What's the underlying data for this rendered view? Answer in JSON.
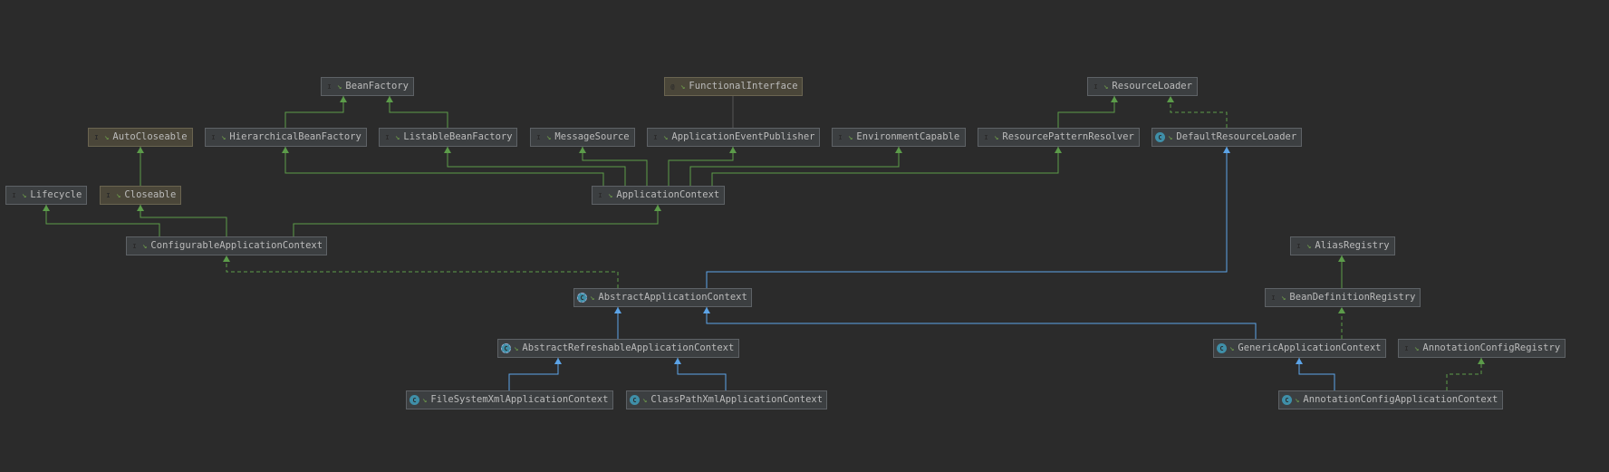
{
  "colors": {
    "background": "#2b2b2b",
    "interface_extends": "#5c9c4a",
    "class_extends": "#5ca4e8",
    "implements": "#5c9c4a"
  },
  "nodes": {
    "beanfactory": {
      "label": "BeanFactory",
      "kind": "interface"
    },
    "functionalinterface": {
      "label": "FunctionalInterface",
      "kind": "annotation"
    },
    "resourceloader": {
      "label": "ResourceLoader",
      "kind": "interface"
    },
    "autocloseable": {
      "label": "AutoCloseable",
      "kind": "interface"
    },
    "hierarchicalbeanfactory": {
      "label": "HierarchicalBeanFactory",
      "kind": "interface"
    },
    "listablebeanfactory": {
      "label": "ListableBeanFactory",
      "kind": "interface"
    },
    "messagesource": {
      "label": "MessageSource",
      "kind": "interface"
    },
    "applicationeventpublisher": {
      "label": "ApplicationEventPublisher",
      "kind": "interface"
    },
    "environmentcapable": {
      "label": "EnvironmentCapable",
      "kind": "interface"
    },
    "resourcepatternresolver": {
      "label": "ResourcePatternResolver",
      "kind": "interface"
    },
    "defaultresourceloader": {
      "label": "DefaultResourceLoader",
      "kind": "class"
    },
    "lifecycle": {
      "label": "Lifecycle",
      "kind": "interface"
    },
    "closeable": {
      "label": "Closeable",
      "kind": "interface"
    },
    "applicationcontext": {
      "label": "ApplicationContext",
      "kind": "interface"
    },
    "configurableapplicationcontext": {
      "label": "ConfigurableApplicationContext",
      "kind": "interface"
    },
    "aliasregistry": {
      "label": "AliasRegistry",
      "kind": "interface"
    },
    "abstractapplicationcontext": {
      "label": "AbstractApplicationContext",
      "kind": "abstract-class"
    },
    "beandefinitionregistry": {
      "label": "BeanDefinitionRegistry",
      "kind": "interface"
    },
    "abstractrefreshableapplicationcontext": {
      "label": "AbstractRefreshableApplicationContext",
      "kind": "abstract-class"
    },
    "genericapplicationcontext": {
      "label": "GenericApplicationContext",
      "kind": "class"
    },
    "annotationconfigregistry": {
      "label": "AnnotationConfigRegistry",
      "kind": "interface"
    },
    "filesystemxmlapplicationcontext": {
      "label": "FileSystemXmlApplicationContext",
      "kind": "class"
    },
    "classpathxmlapplicationcontext": {
      "label": "ClassPathXmlApplicationContext",
      "kind": "class"
    },
    "annotationconfigapplicationcontext": {
      "label": "AnnotationConfigApplicationContext",
      "kind": "class"
    }
  },
  "edges": [
    {
      "from": "hierarchicalbeanfactory",
      "to": "beanfactory",
      "type": "interface_extends"
    },
    {
      "from": "listablebeanfactory",
      "to": "beanfactory",
      "type": "interface_extends"
    },
    {
      "from": "closeable",
      "to": "autocloseable",
      "type": "interface_extends"
    },
    {
      "from": "resourcepatternresolver",
      "to": "resourceloader",
      "type": "interface_extends"
    },
    {
      "from": "defaultresourceloader",
      "to": "resourceloader",
      "type": "implements"
    },
    {
      "from": "applicationcontext",
      "to": "hierarchicalbeanfactory",
      "type": "interface_extends"
    },
    {
      "from": "applicationcontext",
      "to": "listablebeanfactory",
      "type": "interface_extends"
    },
    {
      "from": "applicationcontext",
      "to": "messagesource",
      "type": "interface_extends"
    },
    {
      "from": "applicationcontext",
      "to": "applicationeventpublisher",
      "type": "interface_extends"
    },
    {
      "from": "applicationcontext",
      "to": "environmentcapable",
      "type": "interface_extends"
    },
    {
      "from": "applicationcontext",
      "to": "resourcepatternresolver",
      "type": "interface_extends"
    },
    {
      "from": "configurableapplicationcontext",
      "to": "lifecycle",
      "type": "interface_extends"
    },
    {
      "from": "configurableapplicationcontext",
      "to": "closeable",
      "type": "interface_extends"
    },
    {
      "from": "configurableapplicationcontext",
      "to": "applicationcontext",
      "type": "interface_extends"
    },
    {
      "from": "abstractapplicationcontext",
      "to": "configurableapplicationcontext",
      "type": "implements"
    },
    {
      "from": "abstractapplicationcontext",
      "to": "defaultresourceloader",
      "type": "class_extends"
    },
    {
      "from": "abstractrefreshableapplicationcontext",
      "to": "abstractapplicationcontext",
      "type": "class_extends"
    },
    {
      "from": "genericapplicationcontext",
      "to": "abstractapplicationcontext",
      "type": "class_extends"
    },
    {
      "from": "filesystemxmlapplicationcontext",
      "to": "abstractrefreshableapplicationcontext",
      "type": "class_extends"
    },
    {
      "from": "classpathxmlapplicationcontext",
      "to": "abstractrefreshableapplicationcontext",
      "type": "class_extends"
    },
    {
      "from": "beandefinitionregistry",
      "to": "aliasregistry",
      "type": "interface_extends"
    },
    {
      "from": "genericapplicationcontext",
      "to": "beandefinitionregistry",
      "type": "implements"
    },
    {
      "from": "annotationconfigapplicationcontext",
      "to": "genericapplicationcontext",
      "type": "class_extends"
    },
    {
      "from": "annotationconfigapplicationcontext",
      "to": "annotationconfigregistry",
      "type": "implements"
    }
  ]
}
